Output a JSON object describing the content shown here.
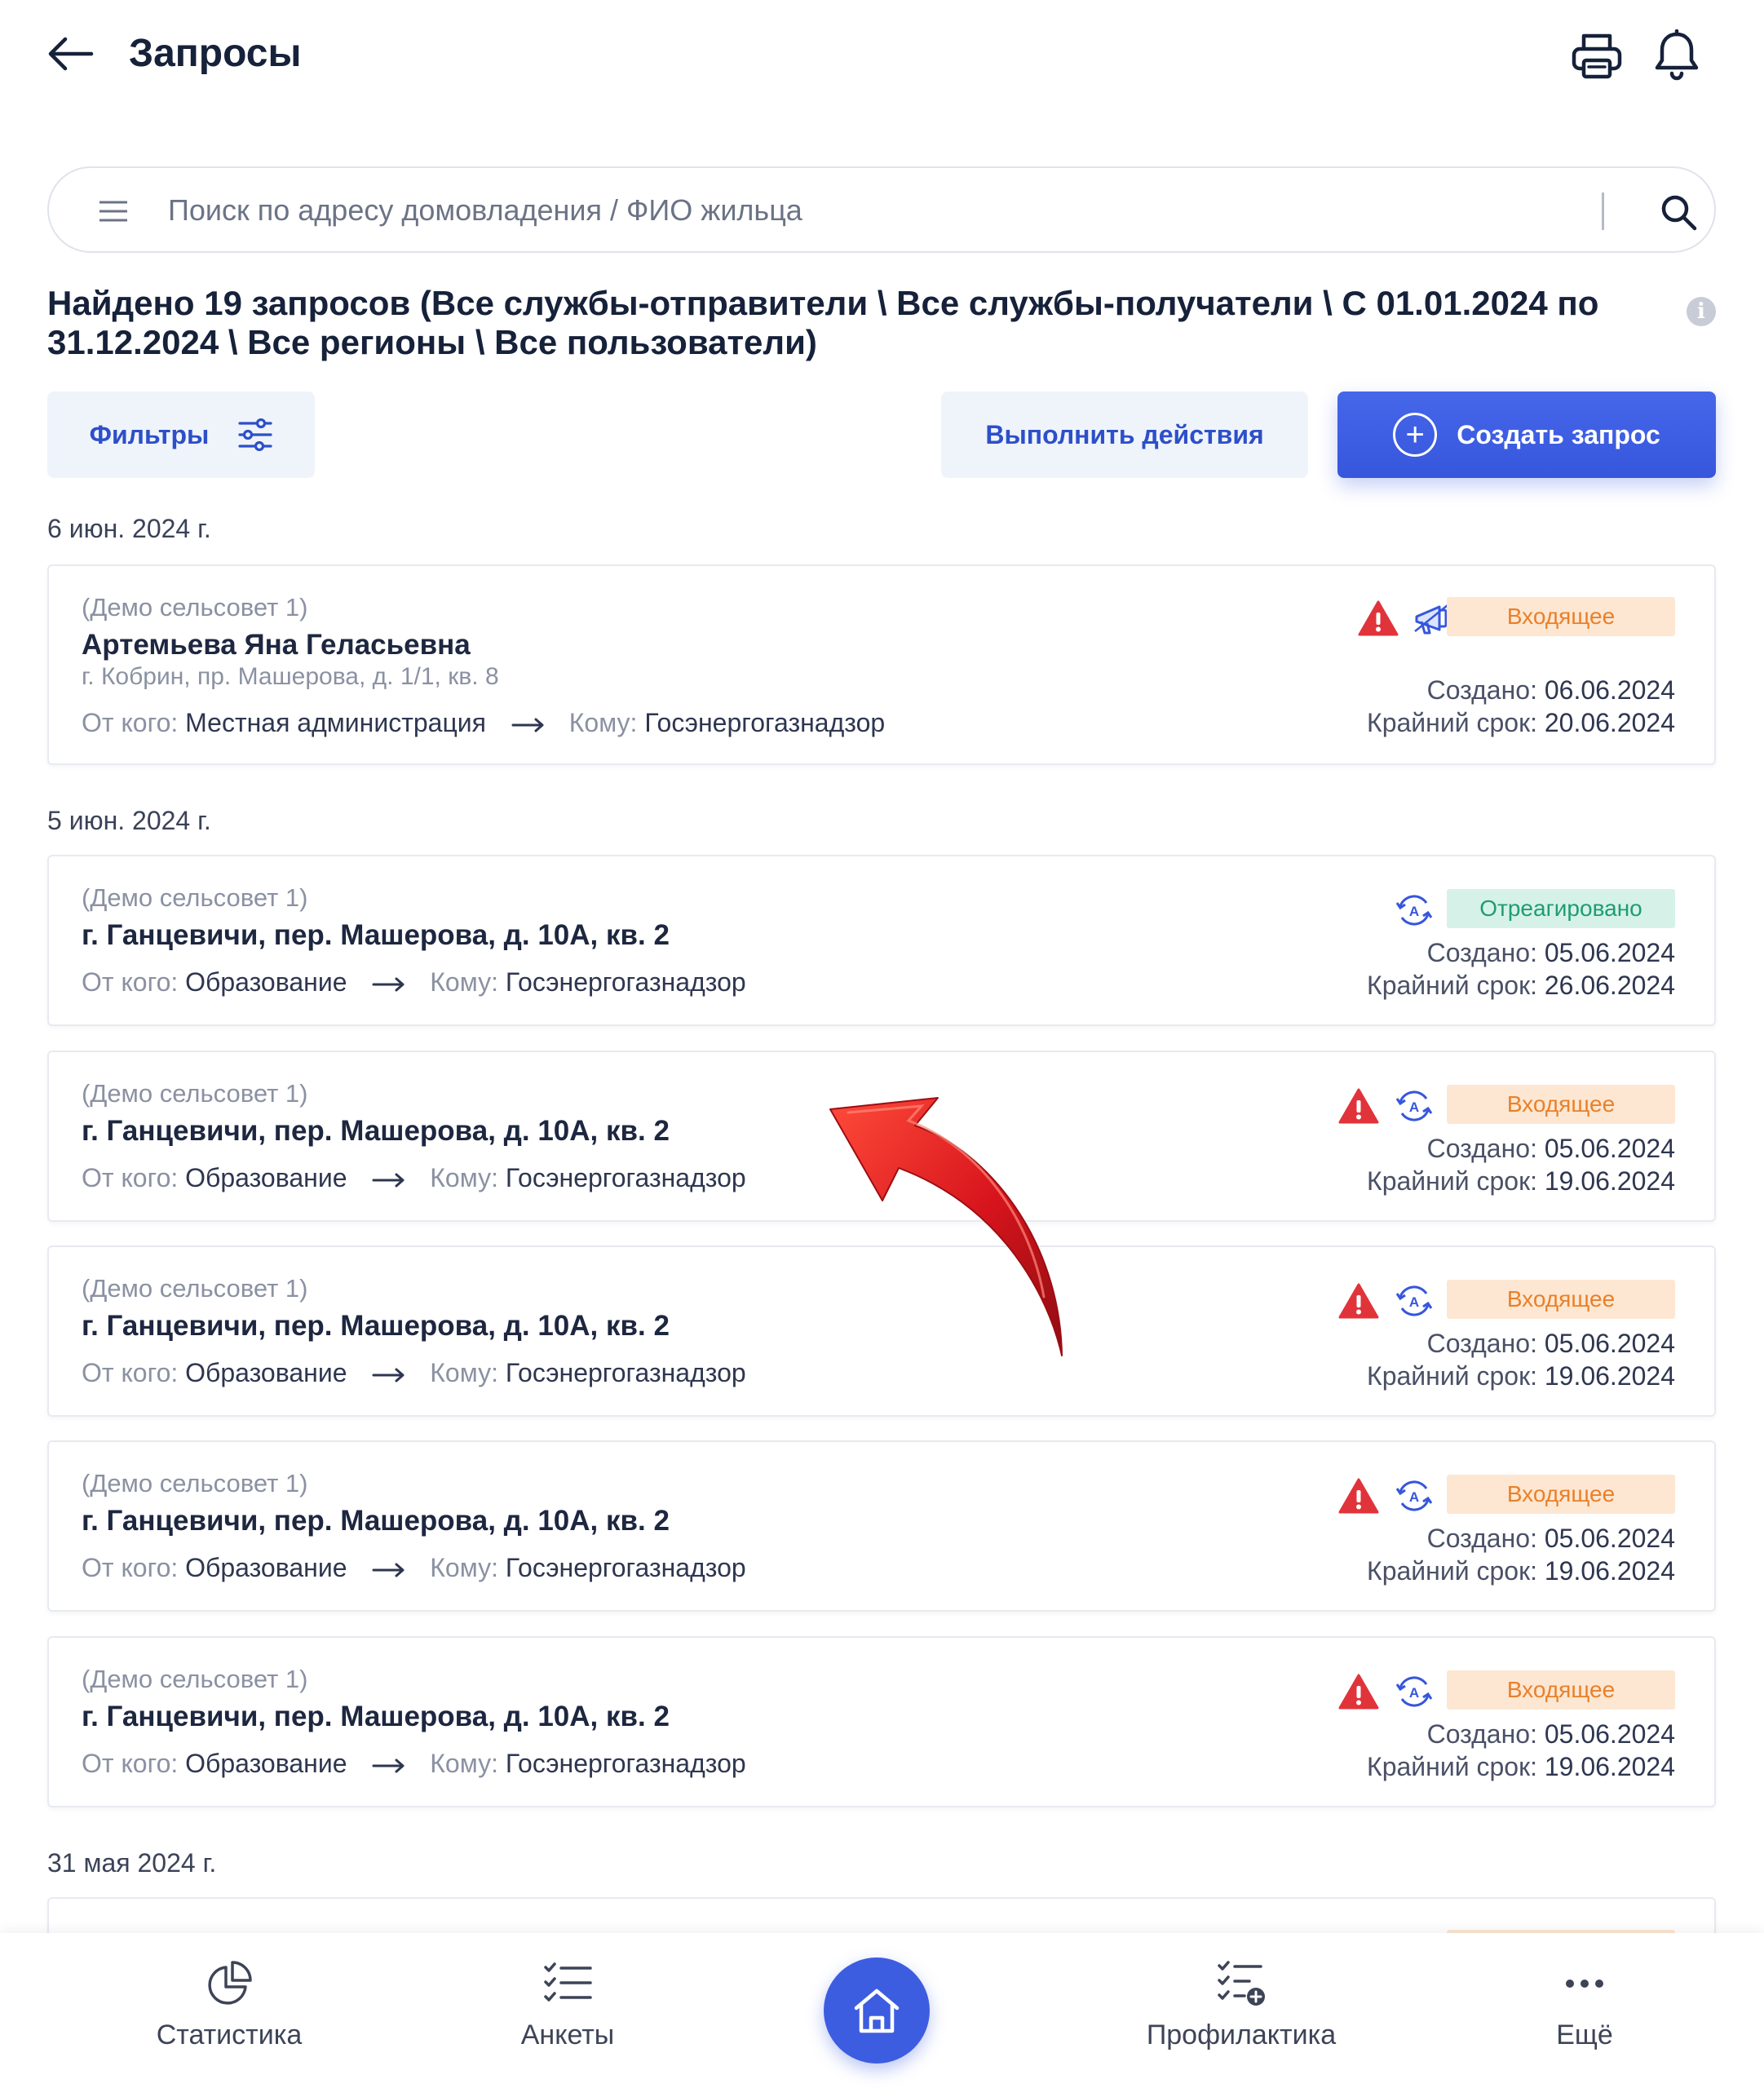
{
  "header": {
    "title": "Запросы",
    "back_icon": "arrow-left-icon",
    "print_icon": "printer-icon",
    "bell_icon": "bell-icon"
  },
  "search": {
    "placeholder": "Поиск по адресу домовладения / ФИО жильца",
    "value": ""
  },
  "summary": {
    "text": "Найдено 19 запросов (Все службы-отправители \\ Все службы-получатели \\ С 01.01.2024 по 31.12.2024 \\ Все регионы \\ Все пользователи)"
  },
  "toolbar": {
    "filters_label": "Фильтры",
    "actions_label": "Выполнить действия",
    "create_label": "Создать запрос"
  },
  "colors": {
    "accent": "#3d5de0",
    "incoming_bg": "#fde7d2",
    "incoming_text": "#e9802a",
    "responded_bg": "#d6f2e8",
    "responded_text": "#1e9c72",
    "warning": "#e0343a"
  },
  "groups": [
    {
      "date": "6 июн. 2024 г.",
      "cards": [
        {
          "org": "(Демо сельсовет 1)",
          "name": "Артемьева Яна Геласьевна",
          "address": "г. Кобрин, пр. Машерова, д. 1/1, кв. 8",
          "from_label": "От кого:",
          "from": "Местная администрация",
          "to_label": "Кому:",
          "to": "Госэнергогазнадзор",
          "status": "Входящее",
          "icons": [
            "warning-icon",
            "megaphone-icon"
          ],
          "created_label": "Создано:",
          "created": "06.06.2024",
          "deadline_label": "Крайний срок:",
          "deadline": "20.06.2024"
        }
      ]
    },
    {
      "date": "5 июн. 2024 г.",
      "cards": [
        {
          "org": "(Демо сельсовет 1)",
          "name": "г. Ганцевичи, пер. Машерова, д. 10А, кв. 2",
          "from_label": "От кого:",
          "from": "Образование",
          "to_label": "Кому:",
          "to": "Госэнергогазнадзор",
          "status": "Отреагировано",
          "icons": [
            "auto-sync-icon"
          ],
          "created_label": "Создано:",
          "created": "05.06.2024",
          "deadline_label": "Крайний срок:",
          "deadline": "26.06.2024"
        },
        {
          "org": "(Демо сельсовет 1)",
          "name": "г. Ганцевичи, пер. Машерова, д. 10А, кв. 2",
          "from_label": "От кого:",
          "from": "Образование",
          "to_label": "Кому:",
          "to": "Госэнергогазнадзор",
          "status": "Входящее",
          "icons": [
            "warning-icon",
            "auto-sync-icon"
          ],
          "created_label": "Создано:",
          "created": "05.06.2024",
          "deadline_label": "Крайний срок:",
          "deadline": "19.06.2024"
        },
        {
          "org": "(Демо сельсовет 1)",
          "name": "г. Ганцевичи, пер. Машерова, д. 10А, кв. 2",
          "from_label": "От кого:",
          "from": "Образование",
          "to_label": "Кому:",
          "to": "Госэнергогазнадзор",
          "status": "Входящее",
          "icons": [
            "warning-icon",
            "auto-sync-icon"
          ],
          "created_label": "Создано:",
          "created": "05.06.2024",
          "deadline_label": "Крайний срок:",
          "deadline": "19.06.2024"
        },
        {
          "org": "(Демо сельсовет 1)",
          "name": "г. Ганцевичи, пер. Машерова, д. 10А, кв. 2",
          "from_label": "От кого:",
          "from": "Образование",
          "to_label": "Кому:",
          "to": "Госэнергогазнадзор",
          "status": "Входящее",
          "icons": [
            "warning-icon",
            "auto-sync-icon"
          ],
          "created_label": "Создано:",
          "created": "05.06.2024",
          "deadline_label": "Крайний срок:",
          "deadline": "19.06.2024"
        },
        {
          "org": "(Демо сельсовет 1)",
          "name": "г. Ганцевичи, пер. Машерова, д. 10А, кв. 2",
          "from_label": "От кого:",
          "from": "Образование",
          "to_label": "Кому:",
          "to": "Госэнергогазнадзор",
          "status": "Входящее",
          "icons": [
            "warning-icon",
            "auto-sync-icon"
          ],
          "created_label": "Создано:",
          "created": "05.06.2024",
          "deadline_label": "Крайний срок:",
          "deadline": "19.06.2024"
        }
      ]
    },
    {
      "date": "31 мая 2024 г.",
      "cards": []
    }
  ],
  "bottom_nav": {
    "items": [
      {
        "label": "Статистика",
        "icon": "pie-chart-icon"
      },
      {
        "label": "Анкеты",
        "icon": "checklist-icon"
      },
      {
        "label": "",
        "icon": "home-icon"
      },
      {
        "label": "Профилактика",
        "icon": "checklist-add-icon"
      },
      {
        "label": "Ещё",
        "icon": "more-dots-icon"
      }
    ]
  }
}
